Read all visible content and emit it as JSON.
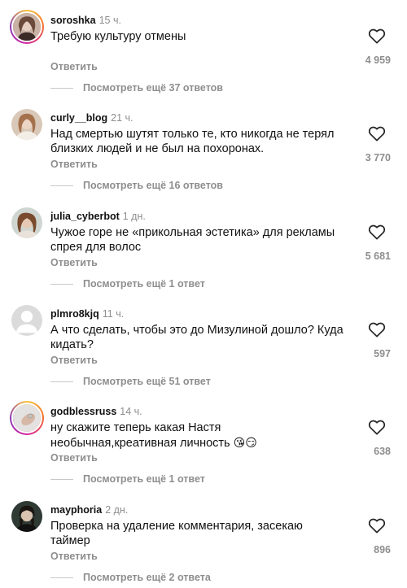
{
  "reply_label": "Ответить",
  "comments": [
    {
      "username": "soroshka",
      "time": "15 ч.",
      "text": "Требую культуру отмены",
      "likes": "4 959",
      "view_replies": "Посмотреть ещё 37 ответов",
      "avatar_icon": "avatar-story-ring"
    },
    {
      "username": "curly__blog",
      "time": "21 ч.",
      "text": "Над смертью шутят только те, кто никогда не терял близких людей и не был на похоронах.",
      "likes": "3 770",
      "view_replies": "Посмотреть ещё 16 ответов",
      "avatar_icon": "avatar-photo"
    },
    {
      "username": "julia_cyberbot",
      "time": "1 дн.",
      "text": "Чужое горе не «прикольная эстетика» для рекламы спрея для волос",
      "likes": "5 681",
      "view_replies": "Посмотреть ещё 1 ответ",
      "avatar_icon": "avatar-photo"
    },
    {
      "username": "plmro8kjq",
      "time": "11 ч.",
      "text": "А что сделать, чтобы это до Мизулиной дошло? Куда кидать?",
      "likes": "597",
      "view_replies": "Посмотреть ещё 51 ответ",
      "avatar_icon": "default-avatar"
    },
    {
      "username": "godblessruss",
      "time": "14 ч.",
      "text": "ну скажите теперь какая Настя необычная,креативная личность",
      "emoji": "😘😏",
      "likes": "638",
      "view_replies": "Посмотреть ещё 1 ответ",
      "avatar_icon": "avatar-story-ring"
    },
    {
      "username": "mayphoria",
      "time": "2 дн.",
      "text": "Проверка на удаление комментария, засекаю таймер",
      "likes": "896",
      "view_replies": "Посмотреть ещё 2 ответа",
      "avatar_icon": "avatar-photo"
    }
  ],
  "colors": {
    "text": "#111111",
    "secondary": "#8e8e8e",
    "divider": "#c7c7c7",
    "story_ring": [
      "#f9c33a",
      "#f46a2d",
      "#d6249f",
      "#8a3ab9"
    ]
  }
}
